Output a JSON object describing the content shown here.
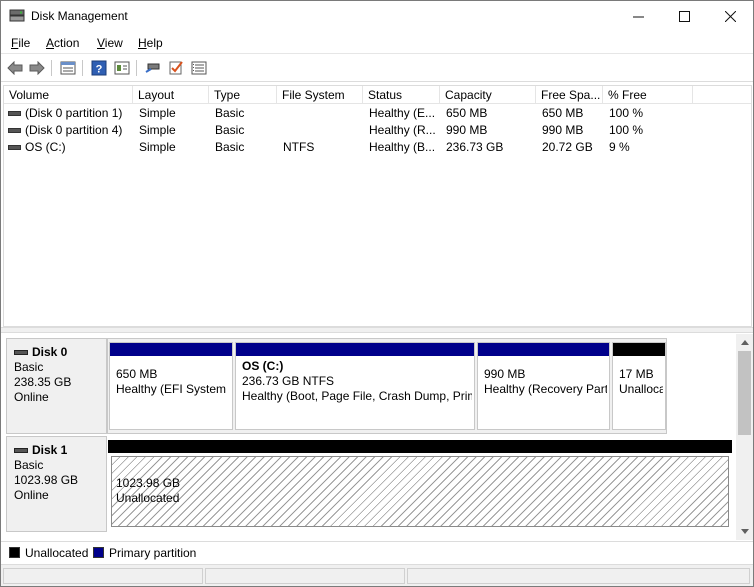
{
  "window": {
    "title": "Disk Management",
    "minimize_glyph": "—",
    "maximize_glyph": "☐",
    "close_glyph": "✕"
  },
  "menu": [
    {
      "label_ul": "F",
      "label_rest": "ile"
    },
    {
      "label_ul": "A",
      "label_rest": "ction"
    },
    {
      "label_ul": "V",
      "label_rest": "iew"
    },
    {
      "label_ul": "H",
      "label_rest": "elp"
    }
  ],
  "toolbar": {
    "icons": [
      "back-arrow-icon",
      "forward-arrow-icon",
      "disk-list-icon",
      "help-icon",
      "properties-icon",
      "connect-icon",
      "check-icon",
      "settings-list-icon"
    ]
  },
  "volumes": {
    "columns": [
      "Volume",
      "Layout",
      "Type",
      "File System",
      "Status",
      "Capacity",
      "Free Spa...",
      "% Free"
    ],
    "rows": [
      {
        "volume": "(Disk 0 partition 1)",
        "layout": "Simple",
        "type": "Basic",
        "fs": "",
        "status": "Healthy (E...",
        "capacity": "650 MB",
        "free": "650 MB",
        "pct": "100 %"
      },
      {
        "volume": "(Disk 0 partition 4)",
        "layout": "Simple",
        "type": "Basic",
        "fs": "",
        "status": "Healthy (R...",
        "capacity": "990 MB",
        "free": "990 MB",
        "pct": "100 %"
      },
      {
        "volume": "OS (C:)",
        "layout": "Simple",
        "type": "Basic",
        "fs": "NTFS",
        "status": "Healthy (B...",
        "capacity": "236.73 GB",
        "free": "20.72 GB",
        "pct": "9 %"
      }
    ]
  },
  "disks": [
    {
      "name": "Disk 0",
      "type": "Basic",
      "size": "238.35 GB",
      "status": "Online",
      "partitions": [
        {
          "name": "",
          "size": "650 MB",
          "desc": "Healthy (EFI System P",
          "kind": "primary"
        },
        {
          "name": "OS  (C:)",
          "size": "236.73 GB NTFS",
          "desc": "Healthy (Boot, Page File, Crash Dump, Prim",
          "kind": "primary"
        },
        {
          "name": "",
          "size": "990 MB",
          "desc": "Healthy (Recovery Part",
          "kind": "primary"
        },
        {
          "name": "",
          "size": "17 MB",
          "desc": "Unalloca",
          "kind": "unallocated"
        }
      ]
    },
    {
      "name": "Disk 1",
      "type": "Basic",
      "size": "1023.98 GB",
      "status": "Online",
      "partitions": [
        {
          "name": "",
          "size": "1023.98 GB",
          "desc": "Unallocated",
          "kind": "unallocated"
        }
      ]
    }
  ],
  "legend": [
    {
      "label": "Unallocated",
      "color": "#000000"
    },
    {
      "label": "Primary partition",
      "color": "#00008b"
    }
  ],
  "colors": {
    "primary": "#00008b",
    "unallocated": "#000000"
  }
}
